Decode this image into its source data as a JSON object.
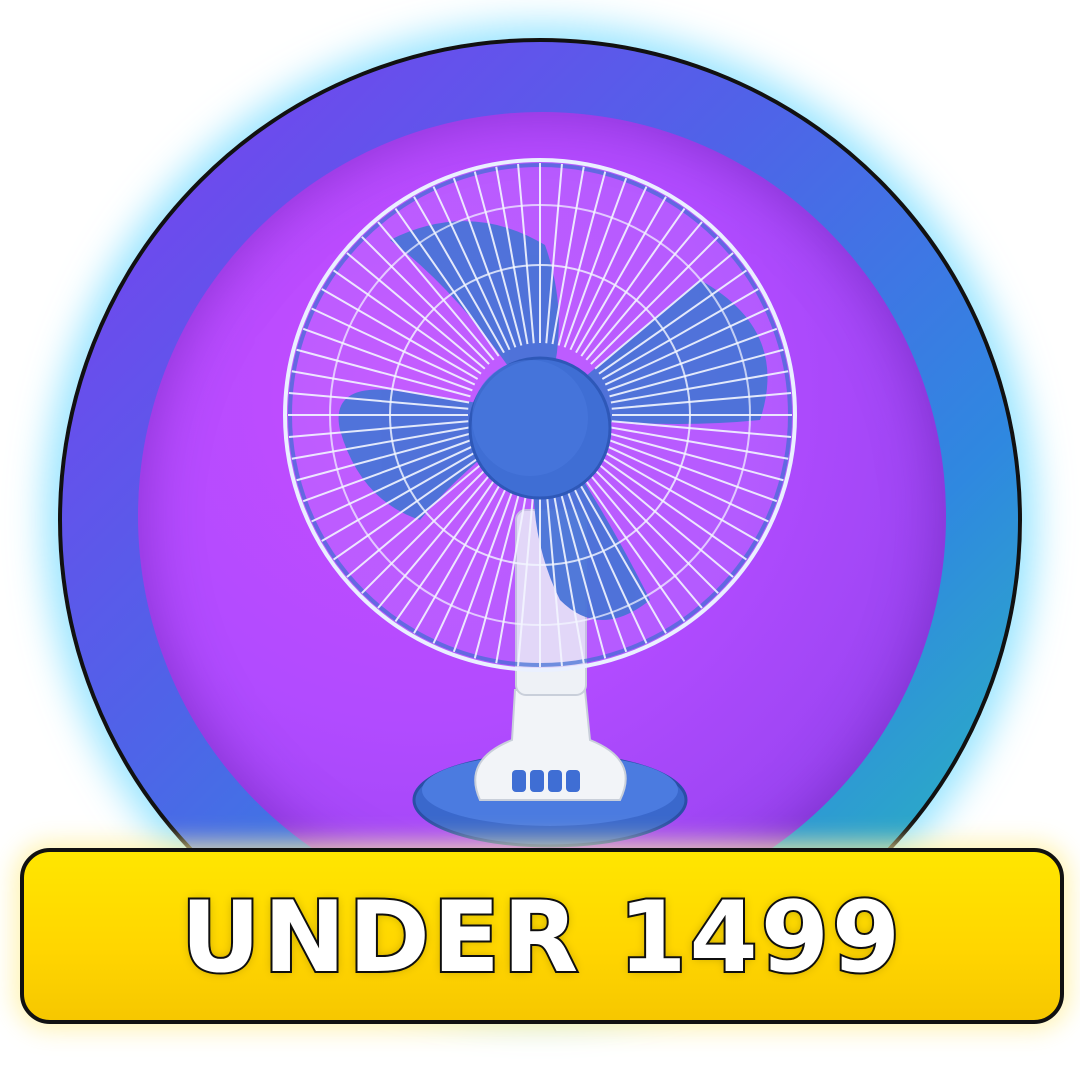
{
  "banner": {
    "price_text": "UNDER 1499"
  },
  "colors": {
    "ring_gradient_start": "#7d3df0",
    "ring_gradient_end": "#29c2b6",
    "inner_disc": "#b14bff",
    "fan_blue": "#3f6ed4",
    "fan_white": "#f2f4f8",
    "banner_yellow": "#ffd500"
  },
  "icons": {
    "product": "table-fan-icon"
  }
}
